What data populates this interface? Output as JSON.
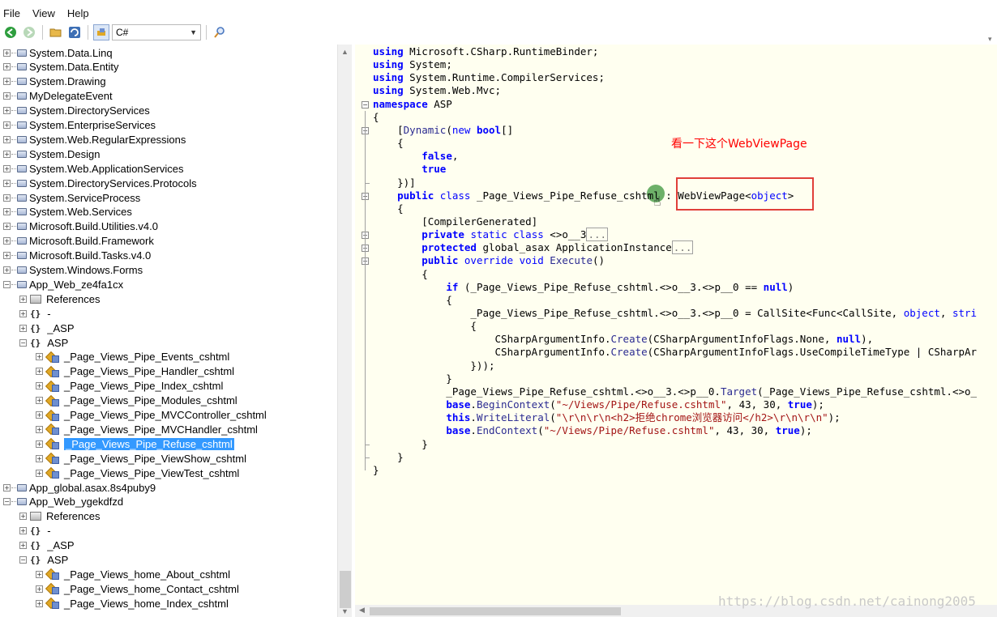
{
  "menu": [
    "File",
    "View",
    "Help"
  ],
  "toolbar": {
    "language": "C#",
    "icons": [
      "back-icon",
      "forward-icon",
      "open-icon",
      "refresh-icon",
      "settings-icon",
      "search-icon"
    ]
  },
  "tree": [
    {
      "label": "System.Data.Linq",
      "indent": 0,
      "exp": "+",
      "icon": "asm"
    },
    {
      "label": "System.Data.Entity",
      "indent": 0,
      "exp": "+",
      "icon": "asm"
    },
    {
      "label": "System.Drawing",
      "indent": 0,
      "exp": "+",
      "icon": "asm"
    },
    {
      "label": "MyDelegateEvent",
      "indent": 0,
      "exp": "+",
      "icon": "asm"
    },
    {
      "label": "System.DirectoryServices",
      "indent": 0,
      "exp": "+",
      "icon": "asm"
    },
    {
      "label": "System.EnterpriseServices",
      "indent": 0,
      "exp": "+",
      "icon": "asm"
    },
    {
      "label": "System.Web.RegularExpressions",
      "indent": 0,
      "exp": "+",
      "icon": "asm"
    },
    {
      "label": "System.Design",
      "indent": 0,
      "exp": "+",
      "icon": "asm"
    },
    {
      "label": "System.Web.ApplicationServices",
      "indent": 0,
      "exp": "+",
      "icon": "asm"
    },
    {
      "label": "System.DirectoryServices.Protocols",
      "indent": 0,
      "exp": "+",
      "icon": "asm"
    },
    {
      "label": "System.ServiceProcess",
      "indent": 0,
      "exp": "+",
      "icon": "asm"
    },
    {
      "label": "System.Web.Services",
      "indent": 0,
      "exp": "+",
      "icon": "asm"
    },
    {
      "label": "Microsoft.Build.Utilities.v4.0",
      "indent": 0,
      "exp": "+",
      "icon": "asm"
    },
    {
      "label": "Microsoft.Build.Framework",
      "indent": 0,
      "exp": "+",
      "icon": "asm"
    },
    {
      "label": "Microsoft.Build.Tasks.v4.0",
      "indent": 0,
      "exp": "+",
      "icon": "asm"
    },
    {
      "label": "System.Windows.Forms",
      "indent": 0,
      "exp": "+",
      "icon": "asm"
    },
    {
      "label": "App_Web_ze4fa1cx",
      "indent": 0,
      "exp": "-",
      "icon": "asm"
    },
    {
      "label": "References",
      "indent": 1,
      "exp": "+",
      "icon": "ref"
    },
    {
      "label": "-",
      "indent": 1,
      "exp": "+",
      "icon": "ns"
    },
    {
      "label": "_ASP",
      "indent": 1,
      "exp": "+",
      "icon": "ns"
    },
    {
      "label": "ASP",
      "indent": 1,
      "exp": "-",
      "icon": "ns"
    },
    {
      "label": "_Page_Views_Pipe_Events_cshtml",
      "indent": 2,
      "exp": "+",
      "icon": "cls"
    },
    {
      "label": "_Page_Views_Pipe_Handler_cshtml",
      "indent": 2,
      "exp": "+",
      "icon": "cls"
    },
    {
      "label": "_Page_Views_Pipe_Index_cshtml",
      "indent": 2,
      "exp": "+",
      "icon": "cls"
    },
    {
      "label": "_Page_Views_Pipe_Modules_cshtml",
      "indent": 2,
      "exp": "+",
      "icon": "cls"
    },
    {
      "label": "_Page_Views_Pipe_MVCController_cshtml",
      "indent": 2,
      "exp": "+",
      "icon": "cls"
    },
    {
      "label": "_Page_Views_Pipe_MVCHandler_cshtml",
      "indent": 2,
      "exp": "+",
      "icon": "cls"
    },
    {
      "label": "_Page_Views_Pipe_Refuse_cshtml",
      "indent": 2,
      "exp": "+",
      "icon": "cls",
      "selected": true
    },
    {
      "label": "_Page_Views_Pipe_ViewShow_cshtml",
      "indent": 2,
      "exp": "+",
      "icon": "cls"
    },
    {
      "label": "_Page_Views_Pipe_ViewTest_cshtml",
      "indent": 2,
      "exp": "+",
      "icon": "cls"
    },
    {
      "label": "App_global.asax.8s4puby9",
      "indent": 0,
      "exp": "+",
      "icon": "asm"
    },
    {
      "label": "App_Web_ygekdfzd",
      "indent": 0,
      "exp": "-",
      "icon": "asm"
    },
    {
      "label": "References",
      "indent": 1,
      "exp": "+",
      "icon": "ref"
    },
    {
      "label": "-",
      "indent": 1,
      "exp": "+",
      "icon": "ns"
    },
    {
      "label": "_ASP",
      "indent": 1,
      "exp": "+",
      "icon": "ns"
    },
    {
      "label": "ASP",
      "indent": 1,
      "exp": "-",
      "icon": "ns"
    },
    {
      "label": "_Page_Views_home_About_cshtml",
      "indent": 2,
      "exp": "+",
      "icon": "cls"
    },
    {
      "label": "_Page_Views_home_Contact_cshtml",
      "indent": 2,
      "exp": "+",
      "icon": "cls"
    },
    {
      "label": "_Page_Views_home_Index_cshtml",
      "indent": 2,
      "exp": "+",
      "icon": "cls"
    }
  ],
  "code": [
    [
      [
        "kw",
        "using"
      ],
      [
        "t",
        " Microsoft.CSharp.RuntimeBinder;"
      ]
    ],
    [
      [
        "kw",
        "using"
      ],
      [
        "t",
        " System;"
      ]
    ],
    [
      [
        "kw",
        "using"
      ],
      [
        "t",
        " System.Runtime.CompilerServices;"
      ]
    ],
    [
      [
        "kw",
        "using"
      ],
      [
        "t",
        " System.Web.Mvc;"
      ]
    ],
    [
      [
        "kw",
        "namespace"
      ],
      [
        "t",
        " ASP"
      ]
    ],
    [
      [
        "t",
        "{"
      ]
    ],
    [
      [
        "t",
        "    ["
      ],
      [
        "ty",
        "Dynamic"
      ],
      [
        "t",
        "("
      ],
      [
        "kw2",
        "new"
      ],
      [
        "t",
        " "
      ],
      [
        "kw",
        "bool"
      ],
      [
        "t",
        "[]"
      ]
    ],
    [
      [
        "t",
        "    {"
      ]
    ],
    [
      [
        "t",
        "        "
      ],
      [
        "kw",
        "false"
      ],
      [
        "t",
        ","
      ]
    ],
    [
      [
        "t",
        "        "
      ],
      [
        "kw",
        "true"
      ]
    ],
    [
      [
        "t",
        "    })]"
      ]
    ],
    [
      [
        "t",
        "    "
      ],
      [
        "kw",
        "public"
      ],
      [
        "t",
        " "
      ],
      [
        "kw2",
        "class"
      ],
      [
        "t",
        " _Page_Views_Pipe_Refuse_cshtml : WebViewPage<"
      ],
      [
        "kw2",
        "object"
      ],
      [
        "t",
        ">"
      ]
    ],
    [
      [
        "t",
        "    {"
      ]
    ],
    [
      [
        "t",
        "        [CompilerGenerated]"
      ]
    ],
    [
      [
        "t",
        "        "
      ],
      [
        "kw",
        "private"
      ],
      [
        "t",
        " "
      ],
      [
        "kw2",
        "static"
      ],
      [
        "t",
        " "
      ],
      [
        "kw2",
        "class"
      ],
      [
        "t",
        " <>o__3"
      ],
      [
        "c",
        "..."
      ]
    ],
    [
      [
        "t",
        "        "
      ],
      [
        "kw",
        "protected"
      ],
      [
        "t",
        " global_asax ApplicationInstance"
      ],
      [
        "c",
        "..."
      ]
    ],
    [
      [
        "t",
        "        "
      ],
      [
        "kw",
        "public"
      ],
      [
        "t",
        " "
      ],
      [
        "kw2",
        "override"
      ],
      [
        "t",
        " "
      ],
      [
        "kw2",
        "void"
      ],
      [
        "t",
        " "
      ],
      [
        "ty",
        "Execute"
      ],
      [
        "t",
        "()"
      ]
    ],
    [
      [
        "t",
        "        {"
      ]
    ],
    [
      [
        "t",
        "            "
      ],
      [
        "kw",
        "if"
      ],
      [
        "t",
        " (_Page_Views_Pipe_Refuse_cshtml.<>o__3.<>p__0 == "
      ],
      [
        "kw",
        "null"
      ],
      [
        "t",
        ")"
      ]
    ],
    [
      [
        "t",
        "            {"
      ]
    ],
    [
      [
        "t",
        "                _Page_Views_Pipe_Refuse_cshtml.<>o__3.<>p__0 = CallSite<Func<CallSite, "
      ],
      [
        "kw2",
        "object"
      ],
      [
        "t",
        ", "
      ],
      [
        "kw2",
        "stri"
      ]
    ],
    [
      [
        "t",
        "                {"
      ]
    ],
    [
      [
        "t",
        "                    CSharpArgumentInfo."
      ],
      [
        "ty",
        "Create"
      ],
      [
        "t",
        "(CSharpArgumentInfoFlags.None, "
      ],
      [
        "kw",
        "null"
      ],
      [
        "t",
        "),"
      ]
    ],
    [
      [
        "t",
        "                    CSharpArgumentInfo."
      ],
      [
        "ty",
        "Create"
      ],
      [
        "t",
        "(CSharpArgumentInfoFlags.UseCompileTimeType | CSharpAr"
      ]
    ],
    [
      [
        "t",
        "                }));"
      ]
    ],
    [
      [
        "t",
        "            }"
      ]
    ],
    [
      [
        "t",
        "            _Page_Views_Pipe_Refuse_cshtml.<>o__3.<>p__0."
      ],
      [
        "ty",
        "Target"
      ],
      [
        "t",
        "(_Page_Views_Pipe_Refuse_cshtml.<>o_"
      ]
    ],
    [
      [
        "t",
        "            "
      ],
      [
        "kw",
        "base"
      ],
      [
        "t",
        "."
      ],
      [
        "ty",
        "BeginContext"
      ],
      [
        "t",
        "("
      ],
      [
        "str",
        "\"~/Views/Pipe/Refuse.cshtml\""
      ],
      [
        "t",
        ", 43, 30, "
      ],
      [
        "kw",
        "true"
      ],
      [
        "t",
        ");"
      ]
    ],
    [
      [
        "t",
        "            "
      ],
      [
        "kw",
        "this"
      ],
      [
        "t",
        "."
      ],
      [
        "ty",
        "WriteLiteral"
      ],
      [
        "t",
        "("
      ],
      [
        "str",
        "\"\\r\\n\\r\\n<h2>拒绝chrome浏览器访问</h2>\\r\\n\\r\\n\""
      ],
      [
        "t",
        ");"
      ]
    ],
    [
      [
        "t",
        "            "
      ],
      [
        "kw",
        "base"
      ],
      [
        "t",
        "."
      ],
      [
        "ty",
        "EndContext"
      ],
      [
        "t",
        "("
      ],
      [
        "str",
        "\"~/Views/Pipe/Refuse.cshtml\""
      ],
      [
        "t",
        ", 43, 30, "
      ],
      [
        "kw",
        "true"
      ],
      [
        "t",
        ");"
      ]
    ],
    [
      [
        "t",
        "        }"
      ]
    ],
    [
      [
        "t",
        "    }"
      ]
    ],
    [
      [
        "t",
        "}"
      ]
    ]
  ],
  "annotation": "看一下这个WebViewPage",
  "watermark": "https://blog.csdn.net/cainong2005",
  "colors": {
    "selection": "#3399ff",
    "code_bg": "#fffff0",
    "annotation": "#ff0000",
    "keyword": "#0000ff",
    "string": "#a31515"
  }
}
